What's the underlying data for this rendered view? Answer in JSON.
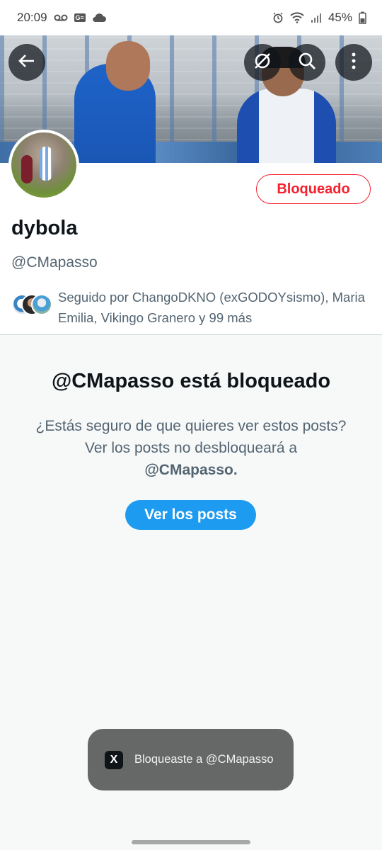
{
  "status_bar": {
    "time": "20:09",
    "battery_percent": "45%",
    "left_icons": [
      "voicemail-icon",
      "gallery-badge-icon",
      "cloud-icon"
    ],
    "right_icons": [
      "alarm-icon",
      "wifi-icon",
      "signal-icon",
      "battery-icon"
    ]
  },
  "header": {
    "back_icon": "arrow-left-icon",
    "grok_icon": "grok-icon",
    "search_icon": "search-icon",
    "more_icon": "more-vertical-icon"
  },
  "profile": {
    "blocked_label": "Bloqueado",
    "display_name": "dybola",
    "handle": "@CMapasso",
    "followed_by": "Seguido por ChangoDKNO (exGODOYsismo), Maria Emilia, Vikingo Granero y 99 más"
  },
  "blocked_notice": {
    "title": "@CMapasso está bloqueado",
    "description": "¿Estás seguro de que quieres ver estos posts? Ver los posts no desbloqueará a",
    "description_handle": "@CMapasso.",
    "button_label": "Ver los posts"
  },
  "toast": {
    "logo": "X",
    "message": "Bloqueaste a @CMapasso"
  },
  "colors": {
    "accent": "#1d9bf0",
    "danger": "#f4212e",
    "secondary_text": "#536471",
    "panel_bg": "#f7f9f9"
  }
}
